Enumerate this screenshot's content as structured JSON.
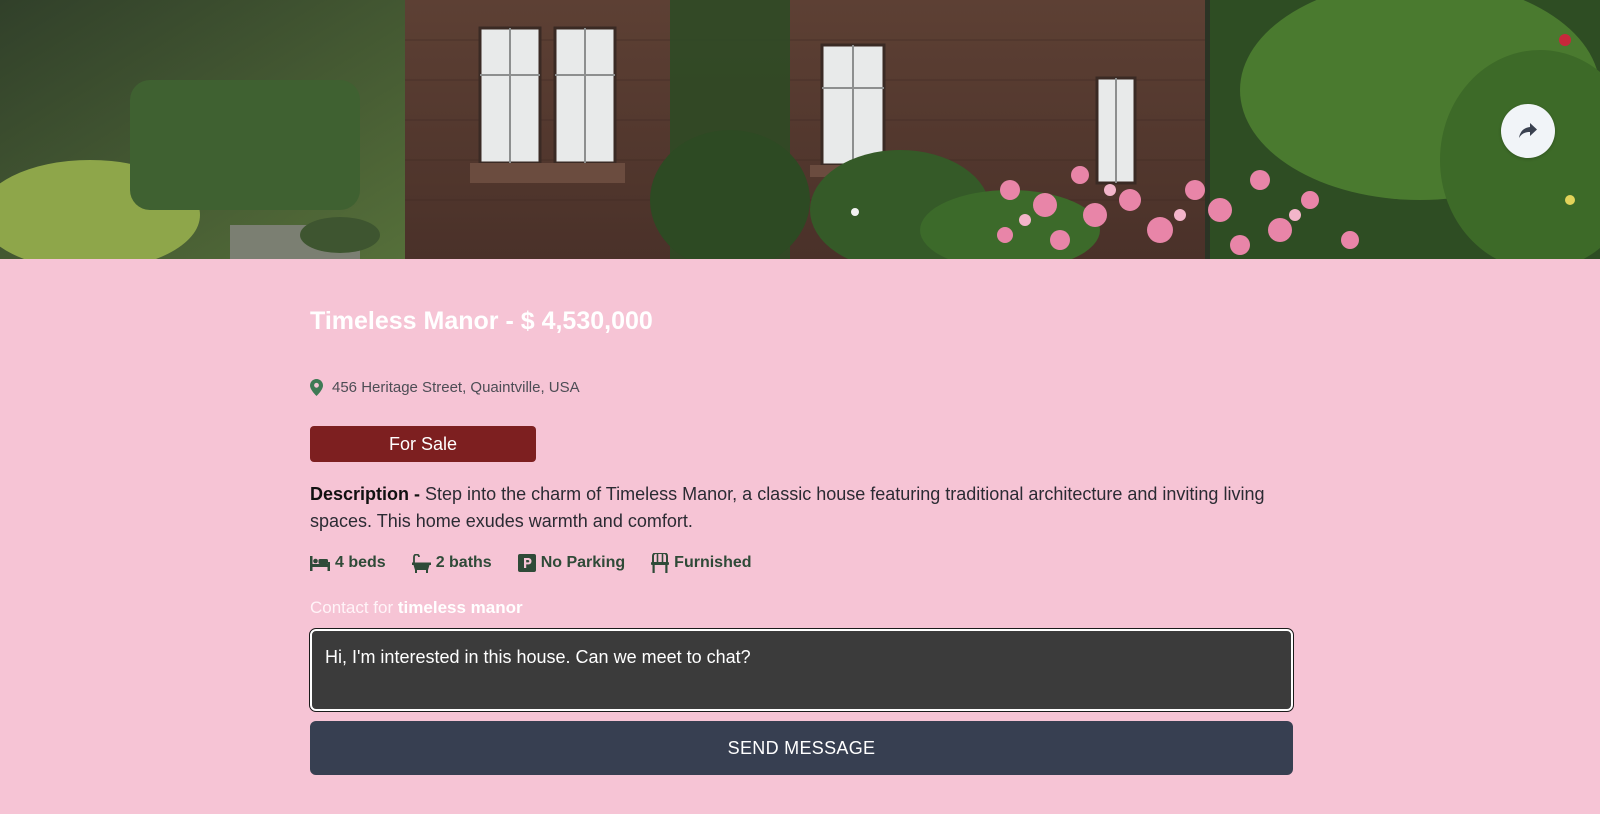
{
  "listing": {
    "title": "Timeless Manor - $ 4,530,000",
    "address": "456 Heritage Street, Quaintville, USA",
    "status": "For Sale",
    "description_label": "Description -",
    "description": "Step into the charm of Timeless Manor, a classic house featuring traditional architecture and inviting living spaces. This home exudes warmth and comfort."
  },
  "features": [
    {
      "icon": "bed-icon",
      "label": "4 beds"
    },
    {
      "icon": "bath-icon",
      "label": "2 baths"
    },
    {
      "icon": "parking-icon",
      "label": "No Parking"
    },
    {
      "icon": "chair-icon",
      "label": "Furnished"
    }
  ],
  "contact": {
    "prefix": "Contact for",
    "name": "timeless manor",
    "message": "Hi, I'm interested in this house. Can we meet to chat?",
    "send_label": "SEND MESSAGE"
  },
  "hero": {
    "image_alt": "Brick manor house with rose garden",
    "share_icon": "share-icon"
  },
  "colors": {
    "background": "#f6c4d5",
    "status_badge": "#7d1f20",
    "button": "#373f51",
    "textarea": "#3b3b3b",
    "icon_green": "#2f4a38"
  }
}
